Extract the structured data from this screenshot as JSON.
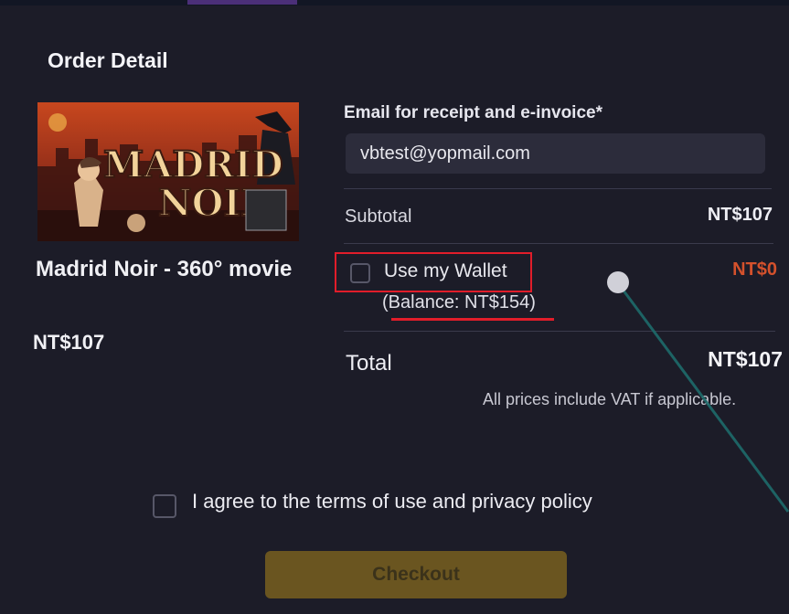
{
  "order": {
    "title": "Order Detail",
    "product": {
      "name": "Madrid Noir - 360° movie",
      "price": "NT$107",
      "poster_title_line1": "MADRID",
      "poster_title_line2": "NOIR"
    },
    "email": {
      "label": "Email for receipt and e-invoice*",
      "value": "vbtest@yopmail.com"
    },
    "subtotal": {
      "label": "Subtotal",
      "value": "NT$107"
    },
    "wallet": {
      "label": "Use my Wallet",
      "balance": "(Balance: NT$154)",
      "amount": "NT$0",
      "checked": false
    },
    "total": {
      "label": "Total",
      "value": "NT$107"
    },
    "vat_note": "All prices include VAT if applicable.",
    "terms": {
      "label": "I agree to the terms of use and privacy policy",
      "checked": false
    },
    "checkout_label": "Checkout"
  },
  "colors": {
    "background": "#1c1c28",
    "input_bg": "#2c2c3b",
    "highlight_red": "#e11d2a",
    "wallet_amount": "#d4512c",
    "checkout_bg": "#6a5520",
    "checkout_text": "#3b321a",
    "pointer_ray": "#1e6b6b"
  }
}
